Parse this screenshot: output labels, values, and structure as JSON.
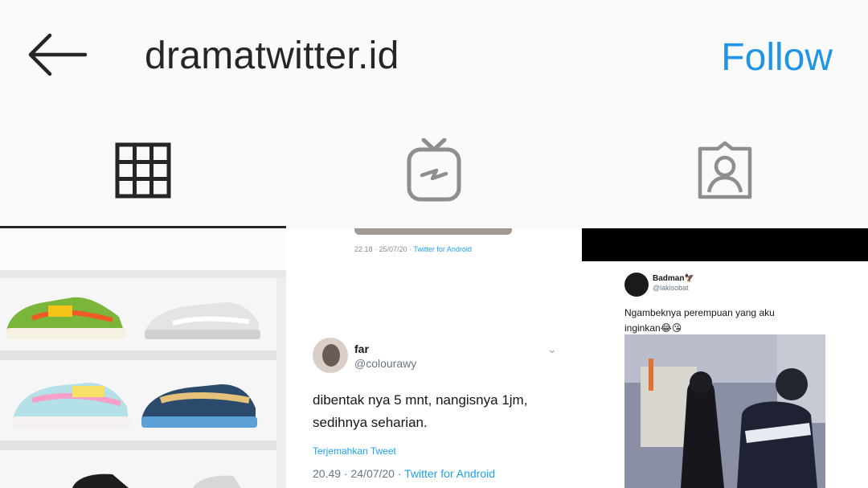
{
  "header": {
    "back_icon": "arrow-left-icon",
    "username": "dramatwitter.id",
    "follow_label": "Follow",
    "follow_color": "#1f95e6"
  },
  "tabs": [
    {
      "icon": "grid-icon",
      "active": true
    },
    {
      "icon": "igtv-icon",
      "active": false
    },
    {
      "icon": "tagged-person-icon",
      "active": false
    }
  ],
  "posts": [
    {
      "type": "image",
      "icon": "sneaker-shelf-photo"
    },
    {
      "type": "image",
      "previous_meta": {
        "time": "22.18 · 25/07/20 · ",
        "source": "Twitter for Android"
      },
      "tweet": {
        "name": "far",
        "handle": "@colourawy",
        "text": "dibentak nya 5 mnt, nangisnya 1jm,\nsedihnya seharian.",
        "translate": "Terjemahkan Tweet",
        "time": "20.49 · 24/07/20 · ",
        "source": "Twitter for Android"
      }
    },
    {
      "type": "video",
      "play_icon": "play-icon",
      "tweet": {
        "name": "Badman🦅",
        "handle": "@lakisobat",
        "text": "Ngambeknya perempuan yang aku\ninginkan😂😘"
      }
    }
  ]
}
